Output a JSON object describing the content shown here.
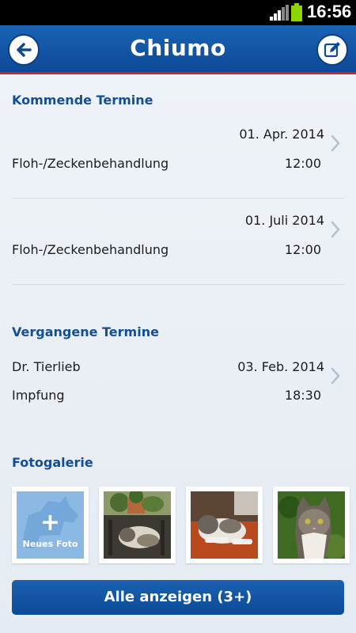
{
  "status": {
    "time": "16:56"
  },
  "header": {
    "title": "Chiumo"
  },
  "upcoming": {
    "heading": "Kommende Termine",
    "items": [
      {
        "date": "01. Apr. 2014",
        "name": "Floh-/Zeckenbehandlung",
        "time": "12:00"
      },
      {
        "date": "01. Juli 2014",
        "name": "Floh-/Zeckenbehandlung",
        "time": "12:00"
      }
    ]
  },
  "past": {
    "heading": "Vergangene Termine",
    "items": [
      {
        "doctor": "Dr. Tierlieb",
        "date": "03. Feb. 2014",
        "name": "Impfung",
        "time": "18:30"
      }
    ]
  },
  "gallery": {
    "heading": "Fotogalerie",
    "new_photo_plus": "+",
    "new_photo_label": "Neues Foto",
    "show_all_label": "Alle anzeigen (3+)"
  },
  "colors": {
    "primary": "#0f55a3",
    "accent_red": "#c8242a",
    "heading": "#134f92"
  }
}
